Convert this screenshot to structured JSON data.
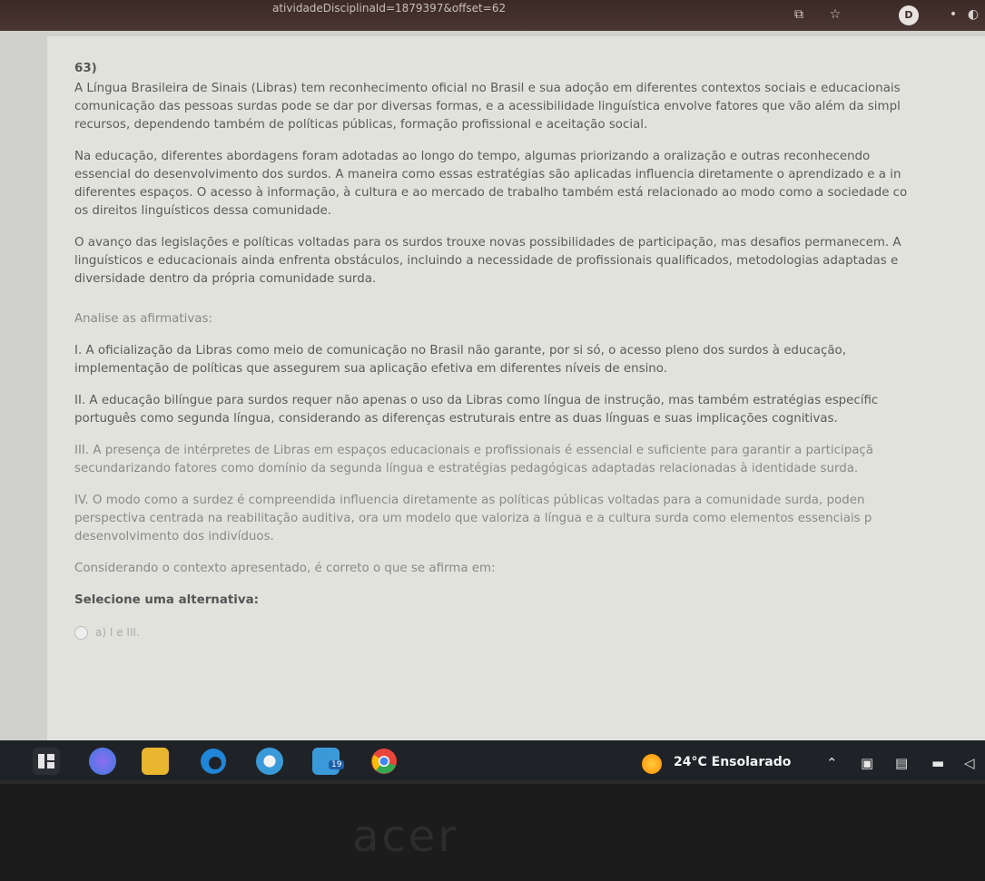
{
  "browser": {
    "url_fragment": "atividadeDisciplinaId=1879397&offset=62",
    "profile_initial": "D"
  },
  "question": {
    "number": "63)",
    "paragraphs": [
      [
        "A Língua Brasileira de Sinais (Libras) tem reconhecimento oficial no Brasil e sua adoção em diferentes contextos sociais e educacionais",
        "comunicação das pessoas surdas pode se dar por diversas formas, e a acessibilidade linguística envolve fatores que vão além da simpl",
        "recursos, dependendo também de políticas públicas, formação profissional e aceitação social."
      ],
      [
        "Na educação, diferentes abordagens foram adotadas ao longo do tempo, algumas priorizando a oralização e outras reconhecendo",
        "essencial do desenvolvimento dos surdos. A maneira como essas estratégias são aplicadas influencia diretamente o aprendizado e a in",
        "diferentes espaços. O acesso à informação, à cultura e ao mercado de trabalho também está relacionado ao modo como a sociedade co",
        "os direitos linguísticos dessa comunidade."
      ],
      [
        "O avanço das legislações e políticas voltadas para os surdos trouxe novas possibilidades de participação, mas desafios permanecem. A",
        "linguísticos e educacionais ainda enfrenta obstáculos, incluindo a necessidade de profissionais qualificados, metodologias adaptadas e",
        "diversidade dentro da própria comunidade surda."
      ]
    ],
    "prompt": "Analise as afirmativas:",
    "statements": [
      [
        "I. A oficialização da Libras como meio de comunicação no Brasil não garante, por si só, o acesso pleno dos surdos à educação,",
        "implementação de políticas que assegurem sua aplicação efetiva em diferentes níveis de ensino."
      ],
      [
        "II. A educação bilíngue para surdos requer não apenas o uso da Libras como língua de instrução, mas também estratégias específic",
        "português como segunda língua, considerando as diferenças estruturais entre as duas línguas e suas implicações cognitivas."
      ],
      [
        "III. A presença de intérpretes de Libras em espaços educacionais e profissionais é essencial e suficiente para garantir a participaçã",
        "secundarizando fatores como domínio da segunda língua e estratégias pedagógicas adaptadas relacionadas à identidade surda."
      ],
      [
        "IV. O modo como a surdez é compreendida influencia diretamente as políticas públicas voltadas para a comunidade surda, poden",
        "perspectiva centrada na reabilitação auditiva, ora um modelo que valoriza a língua e a cultura surda como elementos essenciais p",
        "desenvolvimento dos indivíduos."
      ]
    ],
    "instruction": "Considerando o contexto apresentado, é correto o que se afirma em:",
    "select_label": "Selecione uma alternativa:",
    "options": [
      "a) I e III."
    ]
  },
  "taskbar": {
    "weather": "24°C  Ensolarado",
    "badge": "19",
    "colors": {
      "edge": "#1f86d9",
      "store": "#3a9ad9",
      "chrome": "#e8453c"
    }
  }
}
